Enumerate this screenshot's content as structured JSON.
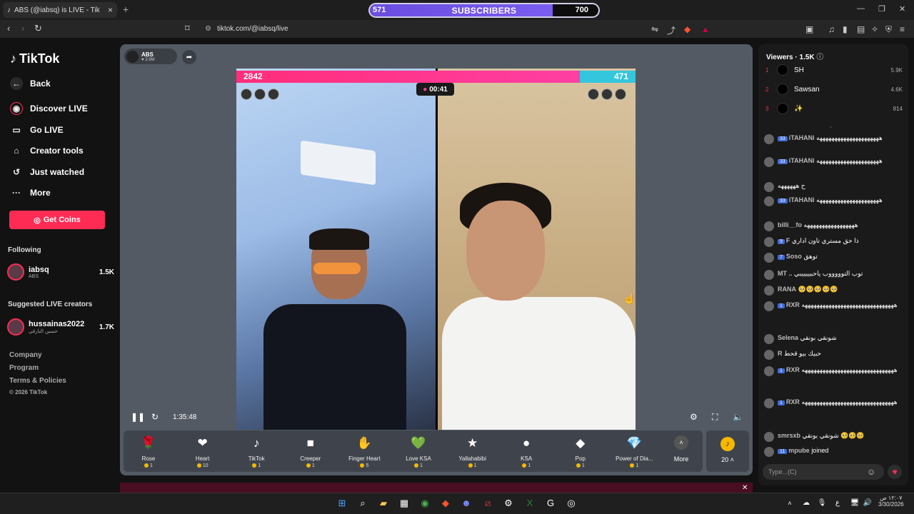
{
  "browser": {
    "tab_title": "ABS (@iabsq) is LIVE - TikTok",
    "url": "tiktok.com/@iabsq/live",
    "sub_left": "571",
    "sub_label": "SUBSCRIBERS",
    "sub_right": "700",
    "sub_progress": 0.8
  },
  "sidebar": {
    "logo": "TikTok",
    "back": "Back",
    "items": [
      "Discover LIVE",
      "Go LIVE",
      "Creator tools",
      "Just watched",
      "More"
    ],
    "get_coins": "Get Coins",
    "following_title": "Following",
    "following": {
      "name": "iabsq",
      "sub": "ABS",
      "count": "1.5K"
    },
    "suggested_title": "Suggested LIVE creators",
    "suggested": {
      "name": "hussainas2022",
      "sub": "حسين البارقي",
      "count": "1.7K"
    },
    "footer": [
      "Company",
      "Program",
      "Terms & Policies",
      "© 2026 TikTok"
    ]
  },
  "stream": {
    "host": "ABS",
    "host_followers": "3.9M",
    "score_left": "2842",
    "score_right": "471",
    "score_left_fraction": 0.86,
    "timer": "00:41",
    "elapsed": "1:35:48"
  },
  "gifts": [
    {
      "name": "Rose",
      "price": "1",
      "icon": "🌹"
    },
    {
      "name": "Heart",
      "price": "10",
      "icon": "❤"
    },
    {
      "name": "TikTok",
      "price": "1",
      "icon": "♪"
    },
    {
      "name": "Creeper",
      "price": "1",
      "icon": "■"
    },
    {
      "name": "Finger Heart",
      "price": "5",
      "icon": "✋"
    },
    {
      "name": "Love KSA",
      "price": "1",
      "icon": "💚"
    },
    {
      "name": "Yallahabibi",
      "price": "1",
      "icon": "★"
    },
    {
      "name": "KSA",
      "price": "1",
      "icon": "●"
    },
    {
      "name": "Pop",
      "price": "1",
      "icon": "◆"
    },
    {
      "name": "Power of Dia...",
      "price": "1",
      "icon": "💎"
    }
  ],
  "gifts_more": "More",
  "balance": "20",
  "viewers": {
    "title": "Viewers · 1.5K",
    "top": [
      {
        "rank": "1",
        "name": "SH",
        "score": "5.9K"
      },
      {
        "rank": "2",
        "name": "Sawsan",
        "score": "4.6K"
      },
      {
        "rank": "3",
        "name": "✨",
        "score": "814"
      }
    ]
  },
  "chat": [
    {
      "badge": "33",
      "user": "iTAHANi",
      "text": "هههههههههههههههههههههه"
    },
    {
      "badge": "33",
      "user": "iTAHANi",
      "text": "هههههههههههههههههههههه"
    },
    {
      "badge": "",
      "user": "ح",
      "text": "ههههههه"
    },
    {
      "badge": "33",
      "user": "iTAHANi",
      "text": "هههههههههههههههههههههه"
    },
    {
      "badge": "",
      "user": "billi__fo",
      "text": "هههههههههههههههههه"
    },
    {
      "badge": "9",
      "user": "F",
      "text": "ذا حق مستري تاون اداري"
    },
    {
      "badge": "7",
      "user": "Soso",
      "text": "توهق"
    },
    {
      "badge": "",
      "user": "MT ..",
      "text": "توب التوووووب ياحبيييييبي"
    },
    {
      "badge": "",
      "user": "RANA",
      "text": "🥺🥺🥺🥺🥺"
    },
    {
      "badge": "1",
      "user": "RXR",
      "text": "هههههههههههههههههههههههههههههههه"
    },
    {
      "badge": "",
      "user": "Selena",
      "text": "شونقي بونقي"
    },
    {
      "badge": "",
      "user": "R",
      "text": "حبيك بيو قحط"
    },
    {
      "badge": "1",
      "user": "RXR",
      "text": "هههههههههههههههههههههههههههههههه"
    },
    {
      "badge": "1",
      "user": "RXR",
      "text": "هههههههههههههههههههههههههههههههه"
    },
    {
      "badge": "",
      "user": "smrsxb",
      "text": "شونقي بونقي 🥺🥺🥺"
    },
    {
      "badge": "11",
      "user": "mpube",
      "text": "joined"
    }
  ],
  "chat_placeholder": "Type...(C)",
  "taskbar": {
    "time": "١٢:٠٧ ص",
    "date": "3/30/2026"
  }
}
